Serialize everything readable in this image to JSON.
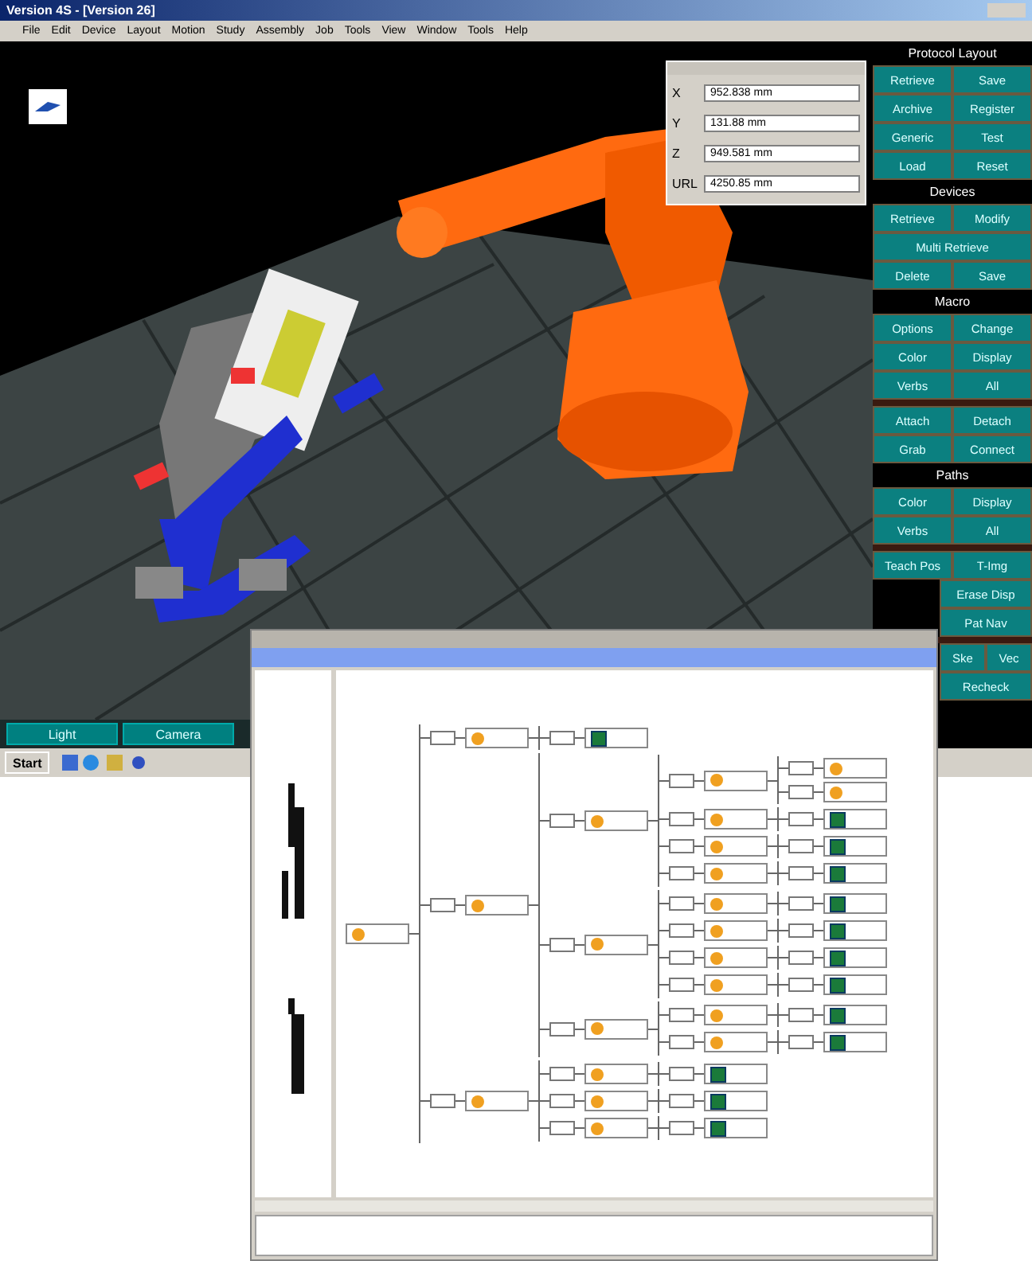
{
  "main_window": {
    "title": "Version 4S - [Version 26]",
    "menu": [
      "File",
      "Edit",
      "Device",
      "Layout",
      "Motion",
      "Study",
      "Assembly",
      "Job",
      "Tools",
      "View",
      "Window",
      "Tools",
      "Help"
    ],
    "coordinates": [
      {
        "axis": "X",
        "value": "952.838 mm"
      },
      {
        "axis": "Y",
        "value": "131.88 mm"
      },
      {
        "axis": "Z",
        "value": "949.581 mm"
      },
      {
        "axis": "URL",
        "value": "4250.85 mm"
      }
    ],
    "panel": [
      {
        "kind": "header",
        "label": "Protocol Layout"
      },
      {
        "kind": "row",
        "buttons": [
          {
            "label": "Retrieve"
          },
          {
            "label": "Save"
          }
        ]
      },
      {
        "kind": "row",
        "buttons": [
          {
            "label": "Archive"
          },
          {
            "label": "Register"
          }
        ]
      },
      {
        "kind": "row",
        "buttons": [
          {
            "label": "Generic"
          },
          {
            "label": "Test"
          }
        ]
      },
      {
        "kind": "row",
        "buttons": [
          {
            "label": "Load"
          },
          {
            "label": "Reset"
          }
        ]
      },
      {
        "kind": "header",
        "label": "Devices"
      },
      {
        "kind": "row",
        "buttons": [
          {
            "label": "Retrieve"
          },
          {
            "label": "Modify"
          }
        ]
      },
      {
        "kind": "row",
        "buttons": [
          {
            "label": "Multi Retrieve"
          }
        ]
      },
      {
        "kind": "row",
        "buttons": [
          {
            "label": "Delete"
          },
          {
            "label": "Save"
          }
        ]
      },
      {
        "kind": "header",
        "label": "Macro"
      },
      {
        "kind": "row",
        "buttons": [
          {
            "label": "Options"
          },
          {
            "label": "Change"
          }
        ]
      },
      {
        "kind": "row",
        "buttons": [
          {
            "label": "Color"
          },
          {
            "label": "Display"
          }
        ]
      },
      {
        "kind": "row",
        "buttons": [
          {
            "label": "Verbs"
          },
          {
            "label": "All"
          }
        ]
      },
      {
        "kind": "separator"
      },
      {
        "kind": "row",
        "buttons": [
          {
            "label": "Attach"
          },
          {
            "label": "Detach"
          }
        ]
      },
      {
        "kind": "row",
        "buttons": [
          {
            "label": "Grab"
          },
          {
            "label": "Connect"
          }
        ]
      },
      {
        "kind": "header",
        "label": "Paths"
      },
      {
        "kind": "row",
        "buttons": [
          {
            "label": "Color"
          },
          {
            "label": "Display"
          }
        ]
      },
      {
        "kind": "row",
        "buttons": [
          {
            "label": "Verbs"
          },
          {
            "label": "All"
          }
        ]
      },
      {
        "kind": "separator"
      },
      {
        "kind": "row",
        "buttons": [
          {
            "label": "Teach Pos"
          },
          {
            "label": "T-Img"
          }
        ]
      },
      {
        "kind": "row",
        "buttons": [
          {
            "kind": "covered"
          },
          {
            "label": "Erase Disp"
          }
        ]
      },
      {
        "kind": "row",
        "buttons": [
          {
            "kind": "covered"
          },
          {
            "label": "Pat Nav"
          }
        ]
      },
      {
        "kind": "separator"
      },
      {
        "kind": "row",
        "buttons": [
          {
            "kind": "covered"
          },
          {
            "label": "Ske"
          },
          {
            "label": "Vec"
          }
        ]
      },
      {
        "kind": "row",
        "buttons": [
          {
            "kind": "covered"
          },
          {
            "label": "Recheck"
          }
        ]
      }
    ],
    "bottom_buttons": [
      "Light",
      "Camera"
    ],
    "start_label": "Start"
  },
  "tree_window": {
    "tree": {
      "kind": "operation",
      "children": [
        {
          "kind": "operation",
          "children": [
            {
              "kind": "resource"
            }
          ]
        },
        {
          "kind": "operation",
          "children": [
            {
              "kind": "operation",
              "children": [
                {
                  "kind": "operation",
                  "children": [
                    {
                      "kind": "operation"
                    },
                    {
                      "kind": "operation"
                    }
                  ]
                },
                {
                  "kind": "operation",
                  "children": [
                    {
                      "kind": "resource"
                    }
                  ]
                },
                {
                  "kind": "operation",
                  "children": [
                    {
                      "kind": "resource"
                    }
                  ]
                },
                {
                  "kind": "operation",
                  "children": [
                    {
                      "kind": "resource"
                    }
                  ]
                }
              ]
            },
            {
              "kind": "operation",
              "children": [
                {
                  "kind": "operation",
                  "children": [
                    {
                      "kind": "resource"
                    }
                  ]
                },
                {
                  "kind": "operation",
                  "children": [
                    {
                      "kind": "resource"
                    }
                  ]
                },
                {
                  "kind": "operation",
                  "children": [
                    {
                      "kind": "resource"
                    }
                  ]
                },
                {
                  "kind": "operation",
                  "children": [
                    {
                      "kind": "resource"
                    }
                  ]
                }
              ]
            },
            {
              "kind": "operation",
              "children": [
                {
                  "kind": "operation",
                  "children": [
                    {
                      "kind": "resource"
                    }
                  ]
                },
                {
                  "kind": "operation",
                  "children": [
                    {
                      "kind": "resource"
                    }
                  ]
                }
              ]
            }
          ]
        },
        {
          "kind": "operation",
          "children": [
            {
              "kind": "operation",
              "children": [
                {
                  "kind": "resource"
                }
              ]
            },
            {
              "kind": "operation",
              "children": [
                {
                  "kind": "resource"
                }
              ]
            },
            {
              "kind": "operation",
              "children": [
                {
                  "kind": "resource"
                }
              ]
            }
          ]
        }
      ]
    }
  }
}
